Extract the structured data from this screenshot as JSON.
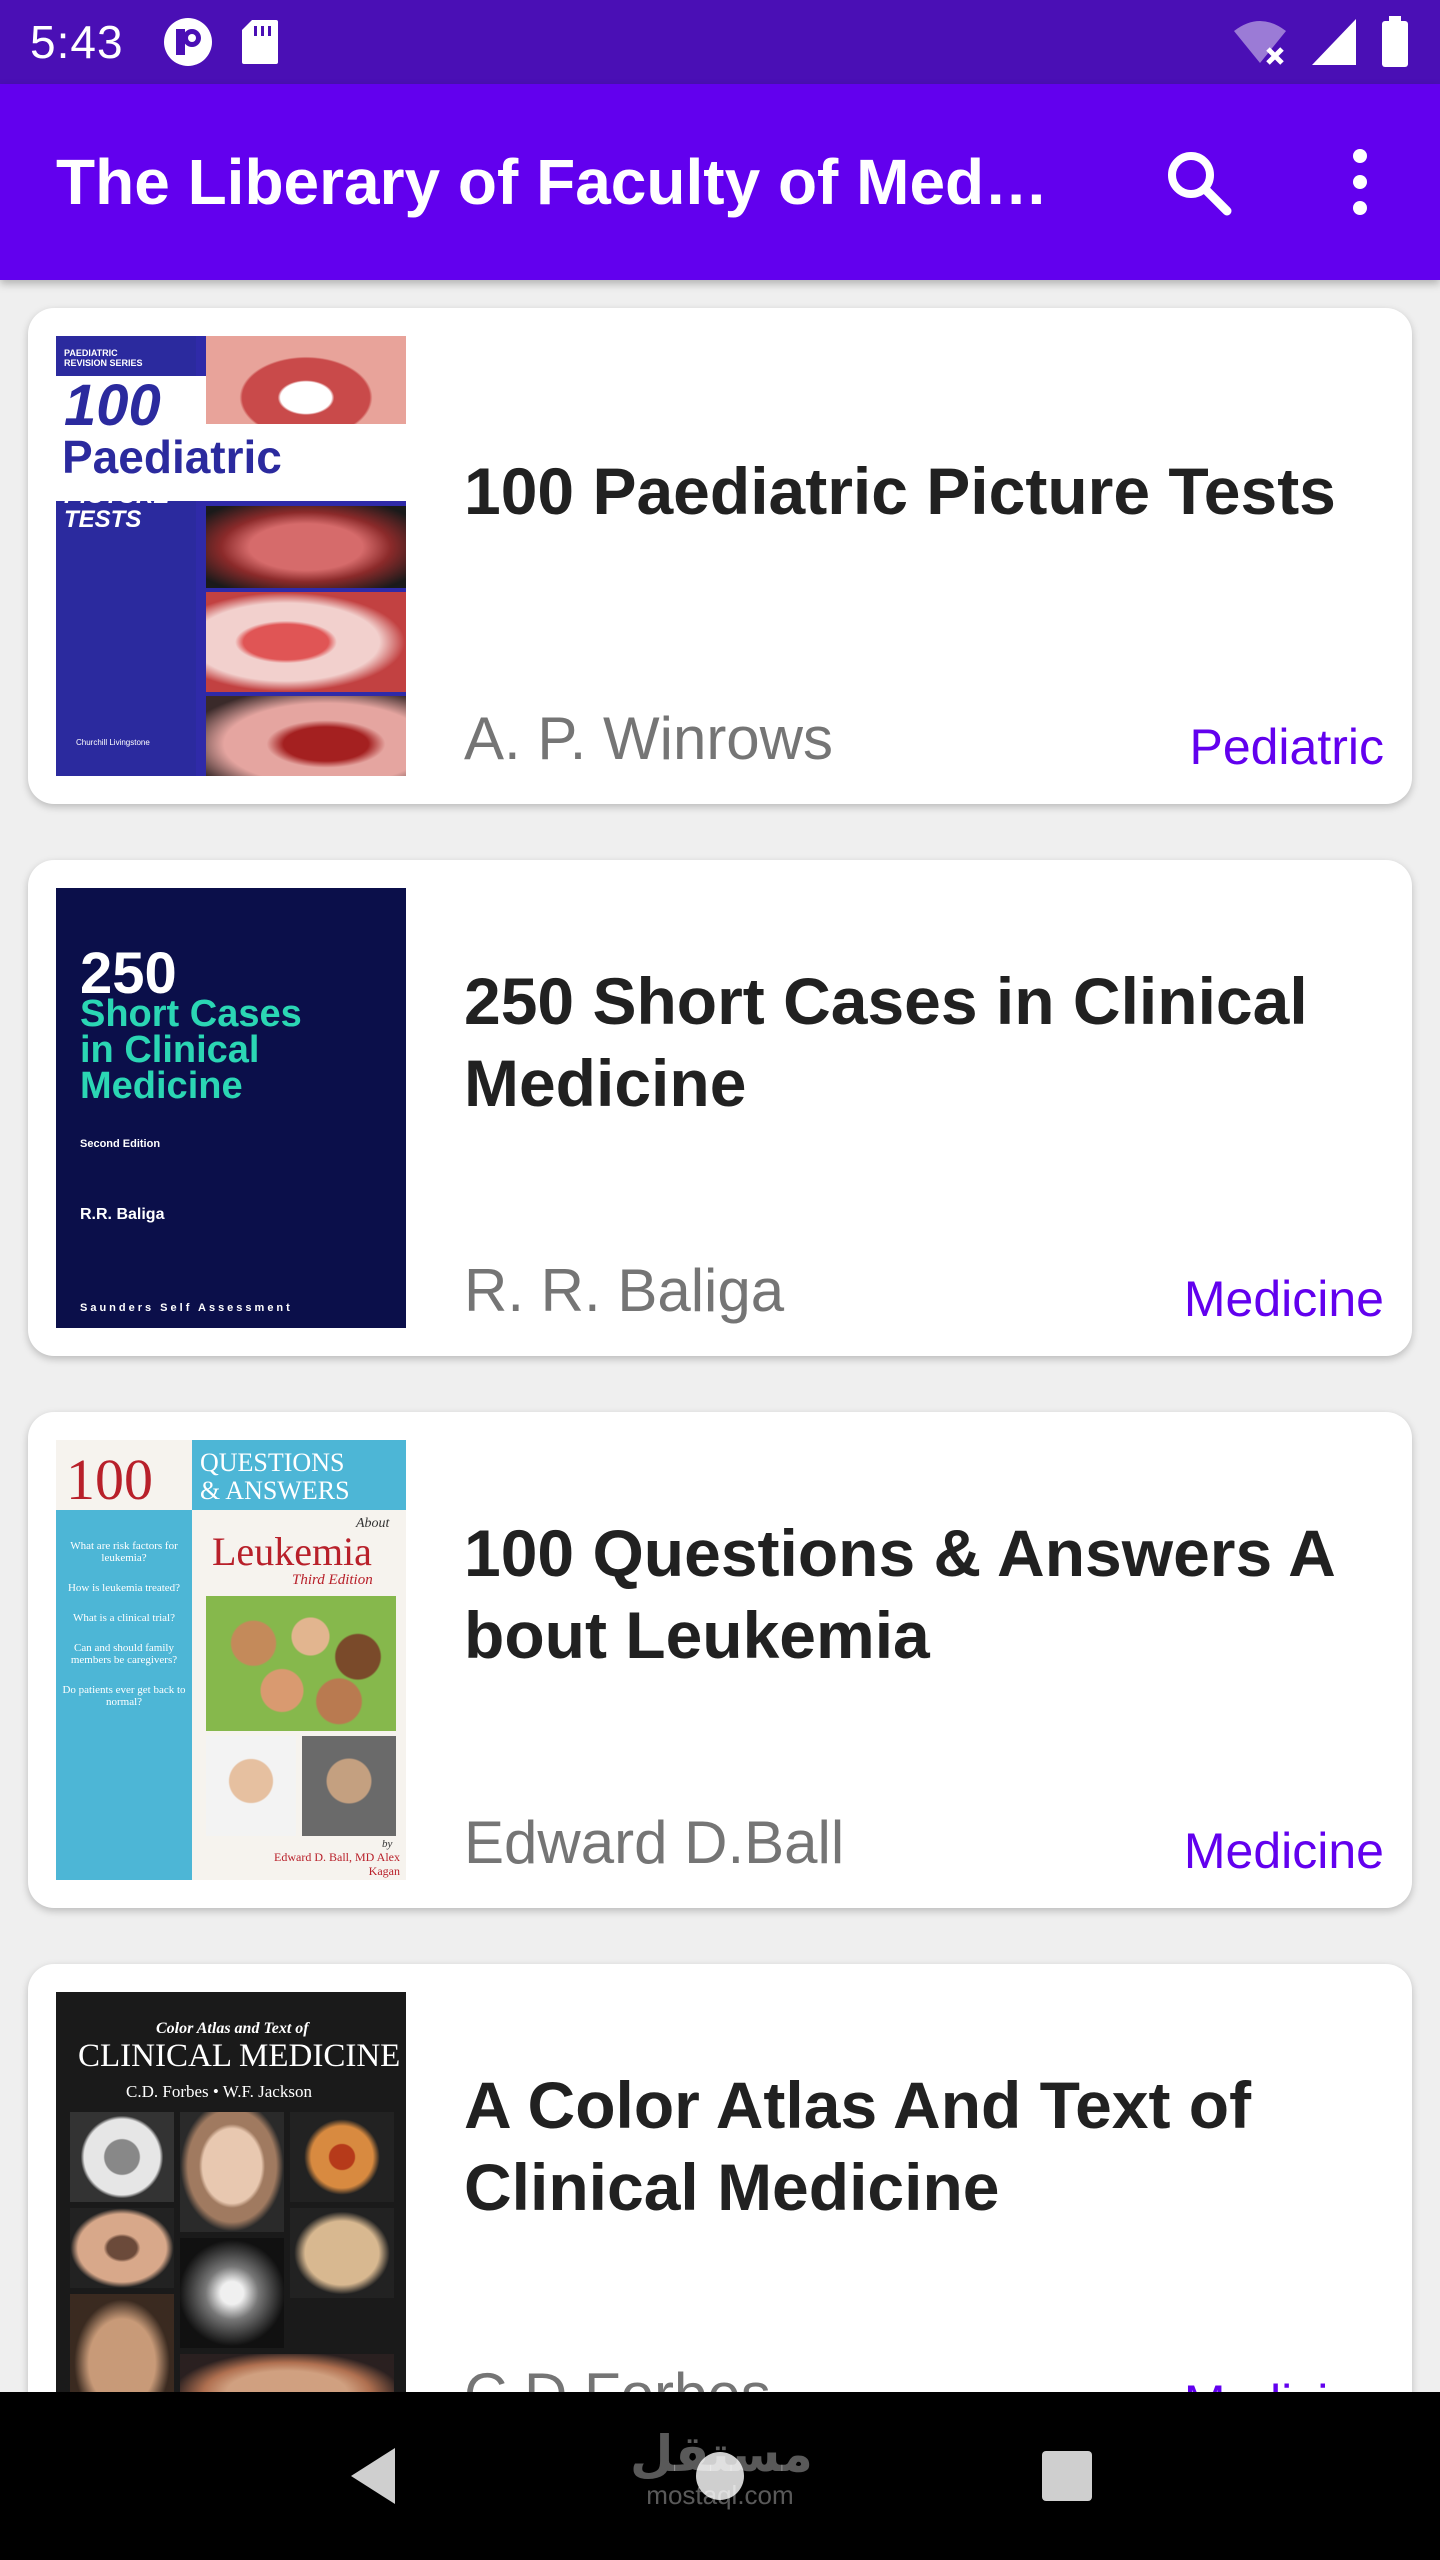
{
  "status_bar": {
    "time": "5:43"
  },
  "app_bar": {
    "title": "The Liberary of Faculty of Med…"
  },
  "books": [
    {
      "title": "100 Paediatric Picture Tests",
      "author": "A. P. Winrows",
      "category": "Pediatric",
      "cover": {
        "series": "PAEDIATRIC REVISION SERIES",
        "number": "100",
        "word": "Paediatric",
        "line1": "PICTURE",
        "line2": "TESTS",
        "publisher": "Churchill Livingstone"
      }
    },
    {
      "title": "250 Short Cases in Clinical Medicine",
      "author": "R. R. Baliga",
      "category": "Medicine",
      "cover": {
        "number": "250",
        "line1": "Short Cases",
        "line2": "in Clinical",
        "line3": "Medicine",
        "edition": "Second Edition",
        "author": "R.R. Baliga",
        "footer": "Saunders Self Assessment"
      }
    },
    {
      "title": "100 Questions & Answers A bout Leukemia",
      "author": "Edward D.Ball",
      "category": "Medicine",
      "cover": {
        "number": "100",
        "qa1": "QUESTIONS",
        "qa2": "& ANSWERS",
        "about": "About",
        "word": "Leukemia",
        "edition": "Third Edition",
        "questions": [
          "What are risk factors for leukemia?",
          "How is leukemia treated?",
          "What is a clinical trial?",
          "Can and should family members be caregivers?",
          "Do patients ever get back to normal?"
        ],
        "by": "by",
        "authors": "Edward D. Ball, MD Alex Kagan"
      }
    },
    {
      "title": "A Color Atlas And Text of Clinical Medicine",
      "author": "C.D.Forbes",
      "category": "Medicine",
      "cover": {
        "top": "Color Atlas and Text of",
        "word": "CLINICAL MEDICINE",
        "authors": "C.D. Forbes • W.F. Jackson"
      }
    }
  ],
  "watermark": {
    "arabic": "مستقل",
    "domain": "mostaql.com"
  },
  "colors": {
    "primary": "#6200ee",
    "primary_dark": "#4a0fb5",
    "title_text": "#212121",
    "author_text": "#757575"
  }
}
